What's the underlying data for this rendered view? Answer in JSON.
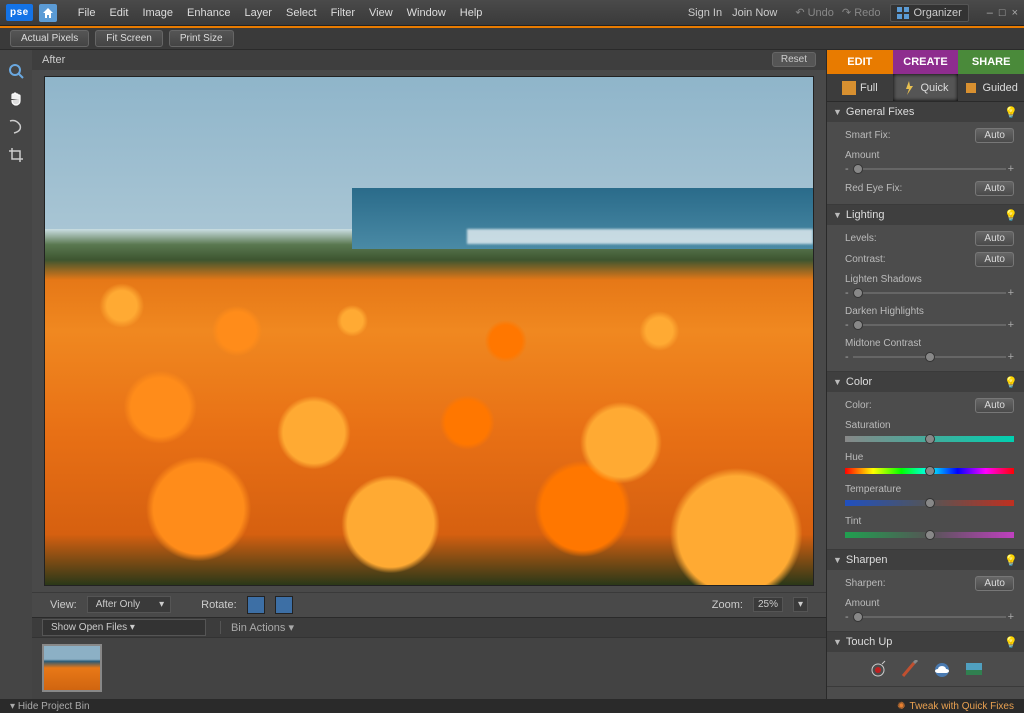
{
  "app": {
    "logo": "pse"
  },
  "menu": [
    "File",
    "Edit",
    "Image",
    "Enhance",
    "Layer",
    "Select",
    "Filter",
    "View",
    "Window",
    "Help"
  ],
  "topright": {
    "signin": "Sign In",
    "joinnow": "Join Now",
    "undo": "Undo",
    "redo": "Redo",
    "organizer": "Organizer"
  },
  "subbar": {
    "actual_pixels": "Actual Pixels",
    "fit_screen": "Fit Screen",
    "print_size": "Print Size"
  },
  "canvas": {
    "label": "After",
    "reset": "Reset"
  },
  "viewrow": {
    "view_label": "View:",
    "view_value": "After Only",
    "rotate_label": "Rotate:",
    "zoom_label": "Zoom:",
    "zoom_value": "25%"
  },
  "bin": {
    "show_open": "Show Open Files",
    "bin_actions": "Bin Actions"
  },
  "footer": {
    "hide_bin": "Hide Project Bin",
    "tweak": "Tweak with Quick Fixes"
  },
  "tabs": {
    "edit": "EDIT",
    "create": "CREATE",
    "share": "SHARE"
  },
  "modes": {
    "full": "Full",
    "quick": "Quick",
    "guided": "Guided"
  },
  "sections": {
    "general": {
      "title": "General Fixes",
      "smartfix": "Smart Fix:",
      "amount": "Amount",
      "redeye": "Red Eye Fix:",
      "auto": "Auto"
    },
    "lighting": {
      "title": "Lighting",
      "levels": "Levels:",
      "contrast": "Contrast:",
      "lighten": "Lighten Shadows",
      "darken": "Darken Highlights",
      "midtone": "Midtone Contrast",
      "auto": "Auto"
    },
    "color": {
      "title": "Color",
      "color": "Color:",
      "saturation": "Saturation",
      "hue": "Hue",
      "temperature": "Temperature",
      "tint": "Tint",
      "auto": "Auto"
    },
    "sharpen": {
      "title": "Sharpen",
      "sharpen": "Sharpen:",
      "amount": "Amount",
      "auto": "Auto"
    },
    "touchup": {
      "title": "Touch Up"
    }
  }
}
